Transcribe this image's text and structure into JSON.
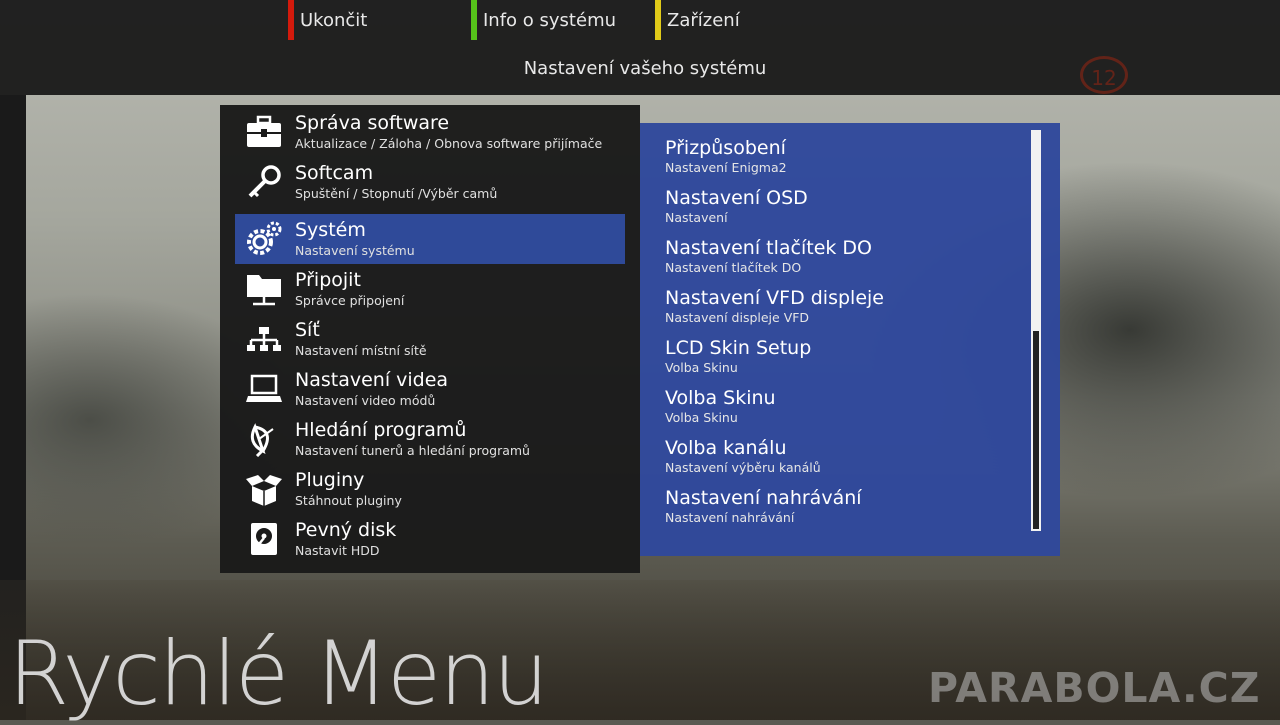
{
  "header": {
    "title": "Nastavení vašeho systému",
    "channel_number": "12",
    "color_keys": [
      {
        "color": "#d31a0c",
        "label": "Ukončit"
      },
      {
        "color": "#55c41a",
        "label": "Info o systému"
      },
      {
        "color": "#e1cb19",
        "label": "Zařízení"
      }
    ]
  },
  "menu": {
    "selected_index": 2,
    "items": [
      {
        "icon": "toolbox-icon",
        "title": "Správa software",
        "subtitle": "Aktualizace / Záloha / Obnova software přijímače"
      },
      {
        "icon": "key-icon",
        "title": "Softcam",
        "subtitle": "Spuštění / Stopnutí /Výběr camů"
      },
      {
        "icon": "gears-icon",
        "title": "Systém",
        "subtitle": "Nastavení systému"
      },
      {
        "icon": "network-folder-icon",
        "title": "Připojit",
        "subtitle": "Správce připojení"
      },
      {
        "icon": "network-icon",
        "title": "Síť",
        "subtitle": "Nastavení místní sítě"
      },
      {
        "icon": "laptop-icon",
        "title": "Nastavení videa",
        "subtitle": "Nastavení video módů"
      },
      {
        "icon": "satellite-dish-icon",
        "title": "Hledání programů",
        "subtitle": "Nastavení tunerů a hledání programů"
      },
      {
        "icon": "open-box-icon",
        "title": "Pluginy",
        "subtitle": "Stáhnout pluginy"
      },
      {
        "icon": "hard-disk-icon",
        "title": "Pevný disk",
        "subtitle": "Nastavit HDD"
      }
    ]
  },
  "submenu": {
    "scroll_fraction": 0.5,
    "items": [
      {
        "title": "Přizpůsobení",
        "subtitle": "Nastavení Enigma2"
      },
      {
        "title": "Nastavení OSD",
        "subtitle": "Nastavení"
      },
      {
        "title": "Nastavení tlačítek DO",
        "subtitle": "Nastavení tlačítek DO"
      },
      {
        "title": "Nastavení VFD displeje",
        "subtitle": "Nastavení displeje VFD"
      },
      {
        "title": "LCD Skin Setup",
        "subtitle": "Volba Skinu"
      },
      {
        "title": "Volba Skinu",
        "subtitle": "Volba Skinu"
      },
      {
        "title": "Volba kanálu",
        "subtitle": "Nastavení výběru kanálů"
      },
      {
        "title": "Nastavení nahrávání",
        "subtitle": "Nastavení nahrávání"
      }
    ]
  },
  "footer": {
    "title": "Rychlé Menu",
    "watermark": "PARABOLA.CZ"
  }
}
